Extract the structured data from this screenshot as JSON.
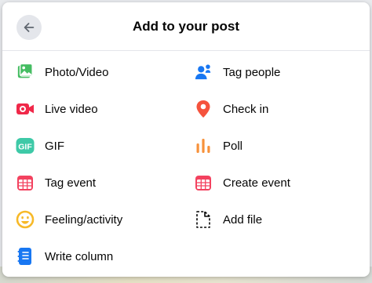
{
  "dialog": {
    "title": "Add to your post",
    "back_label": "Back"
  },
  "options": [
    {
      "label": "Photo/Video",
      "icon": "photo-video-icon",
      "color": "#45bd62"
    },
    {
      "label": "Tag people",
      "icon": "tag-people-icon",
      "color": "#1877f2"
    },
    {
      "label": "Live video",
      "icon": "live-video-icon",
      "color": "#f02849"
    },
    {
      "label": "Check in",
      "icon": "check-in-pin-icon",
      "color": "#f5533d"
    },
    {
      "label": "GIF",
      "icon": "gif-icon",
      "color": "#3ec9a7"
    },
    {
      "label": "Poll",
      "icon": "poll-icon",
      "color": "#f7923b"
    },
    {
      "label": "Tag event",
      "icon": "tag-event-calendar-icon",
      "color": "#f3425f"
    },
    {
      "label": "Create event",
      "icon": "create-event-calendar-icon",
      "color": "#f3425f"
    },
    {
      "label": "Feeling/activity",
      "icon": "feeling-smiley-icon",
      "color": "#f7b928"
    },
    {
      "label": "Add file",
      "icon": "add-file-icon",
      "color": "#050505"
    },
    {
      "label": "Write column",
      "icon": "write-column-icon",
      "color": "#1877f2"
    }
  ]
}
